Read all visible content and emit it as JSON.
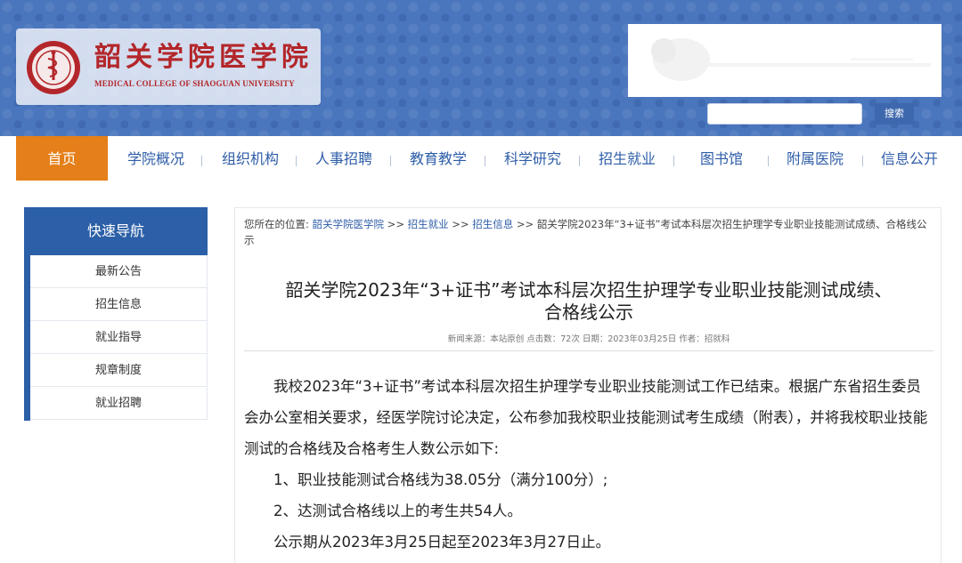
{
  "header": {
    "school_name": "韶关学院医学院",
    "school_name_en": "MEDICAL COLLEGE OF SHAOGUAN UNIVERSITY",
    "search_placeholder": "",
    "search_button": "搜索"
  },
  "nav": {
    "items": [
      "首页",
      "学院概况",
      "组织机构",
      "人事招聘",
      "教育教学",
      "科学研究",
      "招生就业",
      "图书馆",
      "附属医院",
      "信息公开"
    ],
    "active_index": 0,
    "active_color": "#e57f19",
    "link_color": "#2e5da8"
  },
  "sidebar": {
    "title": "快速导航",
    "items": [
      "最新公告",
      "招生信息",
      "就业指导",
      "规章制度",
      "就业招聘"
    ],
    "accent": "#2b5fa7"
  },
  "breadcrumb": {
    "prefix": "您所在的位置:",
    "links": [
      "韶关学院医学院",
      "招生就业",
      "招生信息"
    ],
    "separator": " >> ",
    "current": "韶关学院2023年“3+证书”考试本科层次招生护理学专业职业技能测试成绩、合格线公示"
  },
  "article": {
    "title_line1": "韶关学院2023年“3+证书”考试本科层次招生护理学专业职业技能测试成绩、",
    "title_line2": "合格线公示",
    "meta": "新闻来源：本站原创 点击数：72次 日期：2023年03月25日 作者：招就科",
    "paragraph1": "我校2023年“3+证书”考试本科层次招生护理学专业职业技能测试工作已结束。根据广东省招生委员会办公室相关要求，经医学院讨论决定，公布参加我校职业技能测试考生成绩（附表），并将我校职业技能测试的合格线及合格考生人数公示如下:",
    "item1": "1、职业技能测试合格线为38.05分（满分100分）;",
    "item2": "2、达测试合格线以上的考生共54人。",
    "period": "公示期从2023年3月25日起至2023年3月27日止。"
  }
}
